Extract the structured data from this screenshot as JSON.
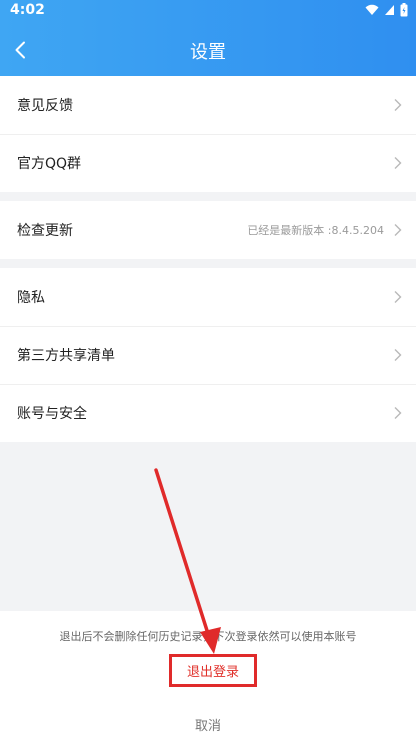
{
  "status_bar": {
    "time": "4:02"
  },
  "header": {
    "title": "设置"
  },
  "groups": [
    {
      "items": [
        {
          "label": "意见反馈"
        },
        {
          "label": "官方QQ群"
        }
      ]
    },
    {
      "items": [
        {
          "label": "检查更新",
          "value": "已经是最新版本 :8.4.5.204"
        }
      ]
    },
    {
      "items": [
        {
          "label": "隐私"
        },
        {
          "label": "第三方共享清单"
        },
        {
          "label": "账号与安全"
        }
      ]
    }
  ],
  "bottom_sheet": {
    "hint": "退出后不会删除任何历史记录，下次登录依然可以使用本账号",
    "logout_label": "退出登录",
    "cancel_label": "取消"
  },
  "colors": {
    "header": "#2f8ff0",
    "annotation": "#e02a2a"
  },
  "icons": [
    "wifi-icon",
    "cell-signal-icon",
    "battery-icon",
    "back-arrow-icon",
    "chevron-right-icon"
  ]
}
